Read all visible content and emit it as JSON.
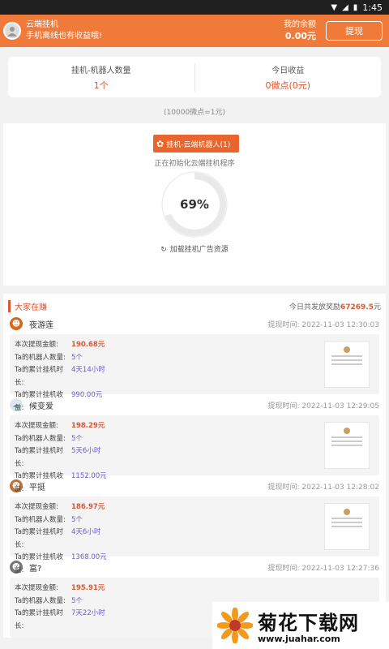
{
  "status_bar": {
    "time": "1:45"
  },
  "header": {
    "title": "云端挂机",
    "subtitle": "手机离线也有收益哦!",
    "balance_label": "我的余额",
    "balance_value": "0.00元",
    "withdraw_label": "提现"
  },
  "stats": {
    "robots_label": "挂机-机器人数量",
    "robots_value": "1个",
    "today_label": "今日收益",
    "today_value": "0微点(0元)",
    "rate": "(10000微点=1元)"
  },
  "robot": {
    "button_label": "挂机-云端机器人(1)",
    "status_text": "正在初始化云端挂机程序",
    "progress_percent": 69,
    "progress_text": "69%",
    "ad_text": "加载挂机广告资源"
  },
  "feed": {
    "title": "大家在赚",
    "today_prefix": "今日共发放奖励",
    "today_amount": "67269.5",
    "today_suffix": "元",
    "labels": {
      "amount": "本次提现金额:",
      "robots": "Ta的机器人数量:",
      "duration": "Ta的累计挂机时长:",
      "earnings": "Ta的累计挂机收益:",
      "time": "提现时间:"
    },
    "entries": [
      {
        "name": "夜游莲",
        "time": "2022-11-03 12:30:03",
        "amount": "190.68元",
        "robots": "5个",
        "duration": "4天14小时",
        "earnings": "990.00元"
      },
      {
        "name": "候变爱",
        "time": "2022-11-03 12:29:05",
        "amount": "198.29元",
        "robots": "5个",
        "duration": "5天6小时",
        "earnings": "1152.00元"
      },
      {
        "name": "平挺",
        "time": "2022-11-03 12:28:02",
        "amount": "186.97元",
        "robots": "5个",
        "duration": "4天6小时",
        "earnings": "1368.00元"
      },
      {
        "name": "富?",
        "time": "2022-11-03 12:27:36",
        "amount": "195.91元",
        "robots": "5个",
        "duration": "7天22小时",
        "earnings": ""
      }
    ]
  },
  "watermark": {
    "title": "菊花下载网",
    "url": "www.juahar.com"
  },
  "colors": {
    "accent": "#f07a3a",
    "highlight": "#e0552e",
    "purple": "#6a5acd"
  }
}
